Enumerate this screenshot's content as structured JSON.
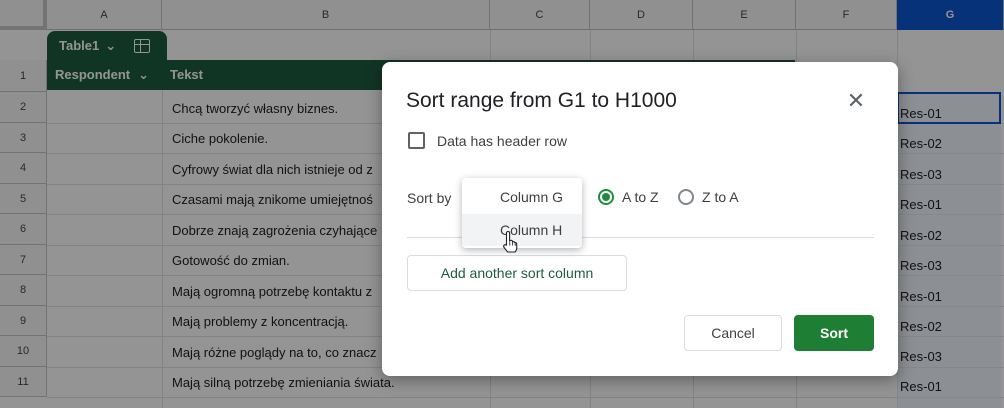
{
  "columns": [
    "A",
    "B",
    "C",
    "D",
    "E",
    "F",
    "G"
  ],
  "selected_column": "G",
  "rows": [
    "1",
    "2",
    "3",
    "4",
    "5",
    "6",
    "7",
    "8",
    "9",
    "10",
    "11"
  ],
  "table": {
    "name": "Table1",
    "headers": [
      "Respondent",
      "Tekst"
    ]
  },
  "cells_b": [
    "Chcą tworzyć własny biznes.",
    "Ciche pokolenie.",
    "Cyfrowy świat dla nich istnieje od z",
    "Czasami mają znikome umiejętnoś",
    "Dobrze znają zagrożenia czyhające",
    "Gotowość do zmian.",
    "Mają ogromną potrzebę kontaktu z",
    "Mają problemy z koncentracją.",
    "Mają różne poglądy na to, co znacz",
    "Mają silną potrzebę zmieniania świata."
  ],
  "cells_g": [
    "Res-01",
    "Res-02",
    "Res-03",
    "Res-01",
    "Res-02",
    "Res-03",
    "Res-01",
    "Res-02",
    "Res-03",
    "Res-01"
  ],
  "dialog": {
    "title": "Sort range from G1 to H1000",
    "header_row_label": "Data has header row",
    "sort_by_label": "Sort by",
    "dropdown_options": [
      "Column G",
      "Column H"
    ],
    "radio_a_to_z": "A to Z",
    "radio_z_to_a": "Z to A",
    "add_sort_label": "Add another sort column",
    "cancel_label": "Cancel",
    "sort_label": "Sort",
    "close_icon": "close-icon"
  },
  "colors": {
    "table_green": "#1e5c40",
    "sort_button": "#1e7e34",
    "selection_blue": "#0b57d0"
  }
}
